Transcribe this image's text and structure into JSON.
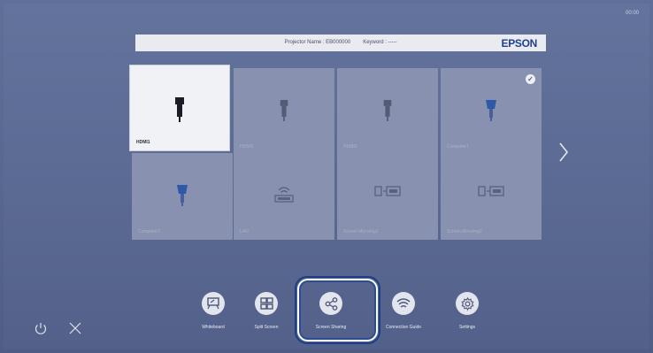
{
  "clock": "00:00",
  "header": {
    "projector_name": "Projector Name : EB000000",
    "keyword": "Keyword : -----",
    "brand": "EPSON"
  },
  "sources": [
    {
      "label": "HDMI1",
      "icon": "hdmi-icon",
      "selected": true
    },
    {
      "label": "HDMI2",
      "icon": "hdmi-icon"
    },
    {
      "label": "HDMI3",
      "icon": "hdmi-icon"
    },
    {
      "label": "Computer1",
      "icon": "vga-icon",
      "checked": true
    },
    {
      "label": "Computer2",
      "icon": "vga-icon"
    },
    {
      "label": "LAN",
      "icon": "lan-icon"
    },
    {
      "label": "Screen Mirroring1",
      "icon": "screen-mirroring-icon"
    },
    {
      "label": "Screen Mirroring2",
      "icon": "screen-mirroring-icon"
    }
  ],
  "dock": [
    {
      "label": "Whiteboard",
      "icon": "whiteboard-icon"
    },
    {
      "label": "Split Screen",
      "icon": "split-screen-icon"
    },
    {
      "label": "Screen Sharing",
      "icon": "share-icon",
      "highlighted": true
    },
    {
      "label": "Connection Guide",
      "icon": "wifi-icon"
    },
    {
      "label": "Settings",
      "icon": "gear-icon"
    }
  ],
  "colors": {
    "brand": "#1f3f91",
    "highlight_border": "#1d3f86",
    "tile": "#8891b0"
  }
}
